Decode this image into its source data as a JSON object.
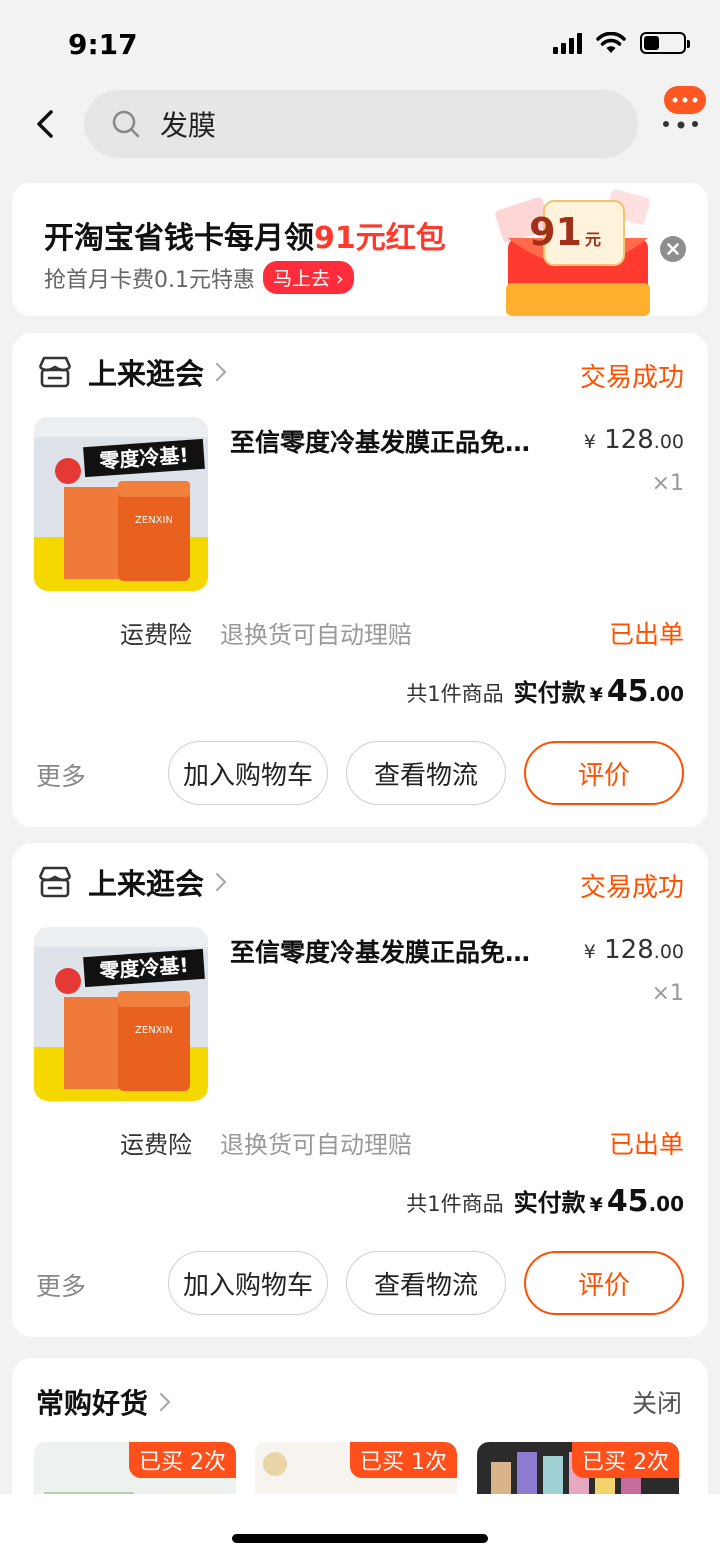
{
  "status_bar": {
    "time": "9:17"
  },
  "search": {
    "query": "发膜"
  },
  "banner": {
    "title_prefix": "开淘宝省钱卡每月领",
    "title_highlight": "91元红包",
    "subtitle": "抢首月卡费0.1元特惠",
    "cta": "马上去",
    "badge_amount": "91",
    "badge_unit": "元"
  },
  "orders": [
    {
      "shop": "上来逛会",
      "status": "交易成功",
      "product_title": "至信零度冷基发膜正品免…",
      "image_text": "零度冷基!",
      "image_brand": "ZENXIN",
      "price_currency": "¥",
      "price_int": "128",
      "price_dec": ".00",
      "qty": "×1",
      "insurance_label": "运费险",
      "insurance_desc": "退换货可自动理赔",
      "shipping_status": "已出单",
      "count_text": "共1件商品",
      "paid_label": "实付款",
      "paid_currency": "¥",
      "paid_int": "45",
      "paid_dec": ".00",
      "more": "更多",
      "btn_cart": "加入购物车",
      "btn_logistics": "查看物流",
      "btn_review": "评价"
    },
    {
      "shop": "上来逛会",
      "status": "交易成功",
      "product_title": "至信零度冷基发膜正品免…",
      "image_text": "零度冷基!",
      "image_brand": "ZENXIN",
      "price_currency": "¥",
      "price_int": "128",
      "price_dec": ".00",
      "qty": "×1",
      "insurance_label": "运费险",
      "insurance_desc": "退换货可自动理赔",
      "shipping_status": "已出单",
      "count_text": "共1件商品",
      "paid_label": "实付款",
      "paid_currency": "¥",
      "paid_int": "45",
      "paid_dec": ".00",
      "more": "更多",
      "btn_cart": "加入购物车",
      "btn_logistics": "查看物流",
      "btn_review": "评价"
    }
  ],
  "frequent": {
    "title": "常购好货",
    "close": "关闭",
    "items": [
      {
        "tag": "已买 2次"
      },
      {
        "tag": "已买 1次"
      },
      {
        "tag": "已买 2次"
      }
    ]
  },
  "colors": {
    "accent": "#ff5000",
    "red": "#ff3a2d"
  }
}
